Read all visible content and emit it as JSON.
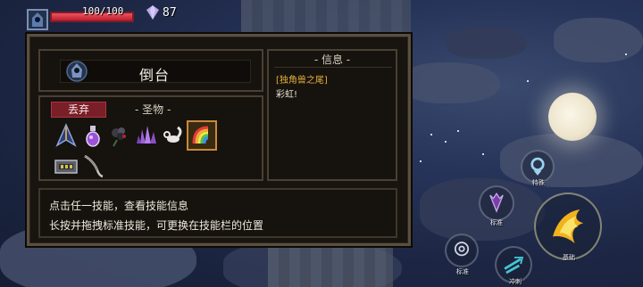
{
  "hud": {
    "hp_text": "100/100",
    "hp_fraction": 1.0,
    "gem_count": "87",
    "colors": {
      "hp": "#e03344",
      "gem": "#b8a9e6"
    }
  },
  "character": {
    "name": "倒台",
    "avatar_icon": "hooded-character-icon"
  },
  "items_panel": {
    "drop_label": "丢弃",
    "relics_label": "- 圣物 -",
    "items": [
      {
        "icon": "dark-wings-icon",
        "selected": false
      },
      {
        "icon": "purple-potion-icon",
        "selected": false
      },
      {
        "icon": "black-rose-icon",
        "selected": false
      },
      {
        "icon": "purple-crystal-icon",
        "selected": false
      },
      {
        "icon": "white-scorpion-icon",
        "selected": false
      },
      {
        "icon": "rainbow-unicorn-tail-icon",
        "selected": true
      },
      {
        "icon": "vip-ticket-icon",
        "selected": false
      },
      {
        "icon": "bone-whip-icon",
        "selected": false
      }
    ]
  },
  "info_panel": {
    "title": "- 信息 -",
    "item_name": "[独角兽之尾]",
    "item_desc": "彩虹!"
  },
  "hint": {
    "line1": "点击任一技能，查看技能信息",
    "line2": "长按并拖拽标准技能，可更换在技能栏的位置"
  },
  "skills": {
    "special": "特殊",
    "standard_top": "标准",
    "standard_bottom": "标准",
    "dash": "冲刺",
    "basic": "基础"
  }
}
